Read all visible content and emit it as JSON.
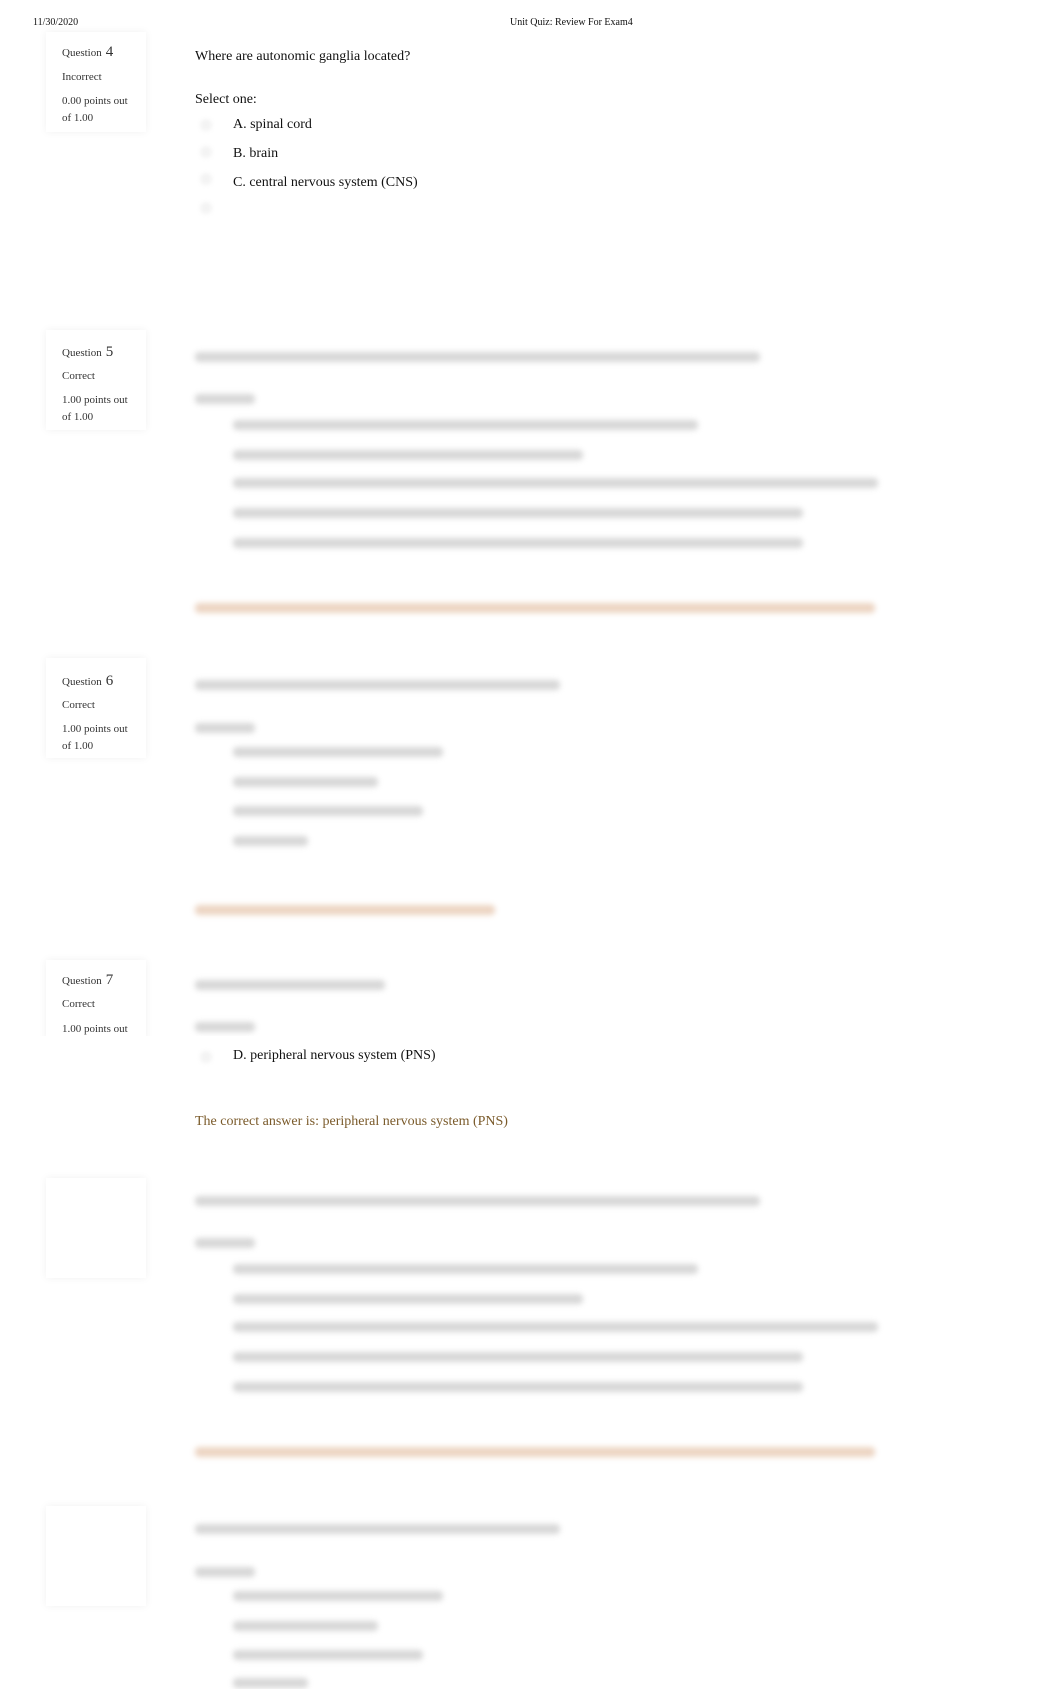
{
  "header": {
    "date": "11/30/2020",
    "title": "Unit Quiz: Review For Exam4"
  },
  "questions": [
    {
      "label": "Question",
      "number": "4",
      "state": "Incorrect",
      "points_line1": "0.00 points out",
      "points_line2": "of 1.00",
      "text": "Where are autonomic ganglia located?",
      "prompt": "Select one:",
      "options": [
        "A. spinal cord",
        "B. brain",
        "C. central nervous system (CNS)"
      ]
    },
    {
      "label": "Question",
      "number": "5",
      "state": "Correct",
      "points_line1": "1.00 points out",
      "points_line2": "of 1.00"
    },
    {
      "label": "Question",
      "number": "6",
      "state": "Correct",
      "points_line1": "1.00 points out",
      "points_line2": "of 1.00"
    },
    {
      "label": "Question",
      "number": "7",
      "state": "Correct",
      "points_line1": "1.00 points out",
      "option_d": "D. peripheral nervous system (PNS)",
      "feedback": "The correct answer is: peripheral nervous system (PNS)"
    }
  ],
  "colors": {
    "feedback": "#7a5a2a"
  }
}
